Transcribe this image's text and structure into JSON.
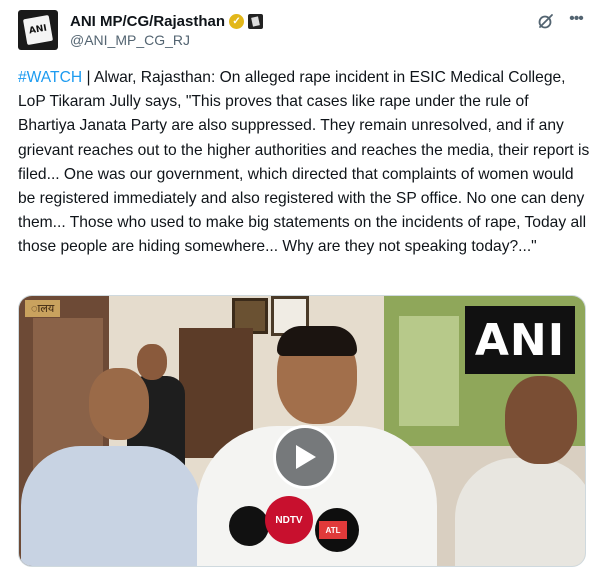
{
  "post": {
    "author": {
      "display_name": "ANI MP/CG/Rajasthan",
      "handle": "@ANI_MP_CG_RJ",
      "avatar_text": "ANI",
      "verified_icon": "gold-check-icon",
      "affiliate_icon": "ani-affiliate-badge-icon"
    },
    "icons": {
      "grok": "grok-icon",
      "more": "more-options-icon",
      "play": "play-icon"
    },
    "text": {
      "hashtag": "#WATCH",
      "body": " | Alwar, Rajasthan: On alleged rape incident in ESIC Medical College, LoP Tikaram Jully says, \"This proves that cases like rape under the rule of Bhartiya Janata Party are also suppressed. They remain unresolved, and if any grievant reaches out to the higher authorities and reaches the media, their report is filed... One was our government, which directed that complaints of women would be registered immediately and also registered with the SP office. No one can deny them... Those who used to make big statements on the incidents of rape, Today all those people are hiding somewhere... Why are they not speaking today?...\""
    },
    "media": {
      "watermark": "ANI",
      "sign_text": "ालय",
      "mic_labels": [
        "NDTV",
        "ATL"
      ]
    }
  },
  "colors": {
    "link": "#1d9bf0",
    "secondary": "#536471",
    "verified": "#e2b719"
  }
}
